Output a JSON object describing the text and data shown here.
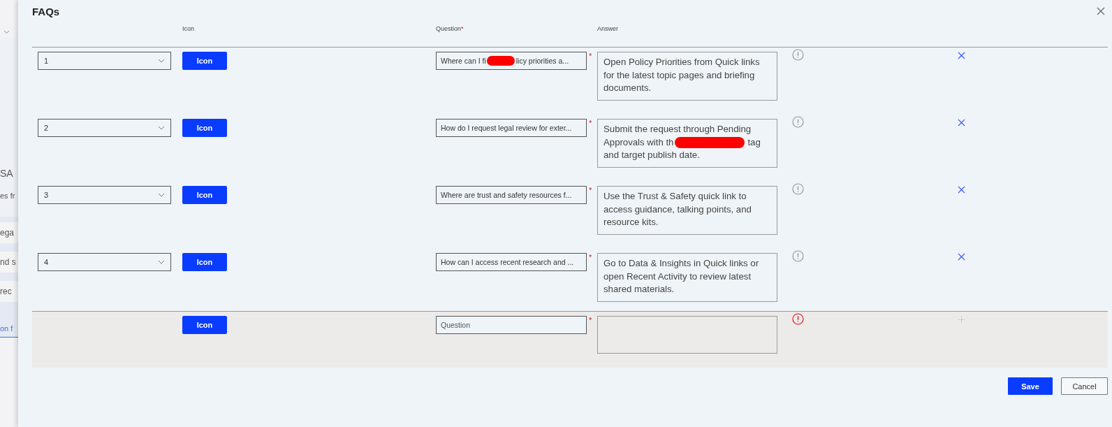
{
  "background_page": {
    "fragments": [
      {
        "kind": "heading",
        "text": "SA"
      },
      {
        "kind": "text",
        "text": "es fr"
      },
      {
        "kind": "chip",
        "text": "ega"
      },
      {
        "kind": "chip",
        "text": "nd s"
      },
      {
        "kind": "chip",
        "text": "rec"
      },
      {
        "kind": "link",
        "text": "on f"
      }
    ]
  },
  "dialog": {
    "title": "FAQs",
    "columns": [
      {
        "label": "Icon"
      },
      {
        "label": "Question",
        "required_mark": "*"
      },
      {
        "label": "Answer"
      }
    ],
    "rows": [
      {
        "kind": "item",
        "order": "1",
        "icon_button": "Icon",
        "question": [
          {
            "kind": "text",
            "text": "Where can I fi"
          },
          {
            "kind": "redaction"
          },
          {
            "kind": "text",
            "text": "licy priorities a..."
          }
        ],
        "required_mark": "*",
        "answer": [
          {
            "kind": "text",
            "text": "Open Policy Priorities from Quick links for the latest topic pages and briefing documents."
          }
        ],
        "error": false
      },
      {
        "kind": "item",
        "order": "2",
        "icon_button": "Icon",
        "question": [
          {
            "kind": "text",
            "text": "How do I request legal review for exter..."
          }
        ],
        "required_mark": "*",
        "answer": [
          {
            "kind": "text",
            "text": "Submit the request through Pending Approvals with th"
          },
          {
            "kind": "redaction"
          },
          {
            "kind": "text",
            "text": "tag and target publish date."
          }
        ],
        "error": false
      },
      {
        "kind": "item",
        "order": "3",
        "icon_button": "Icon",
        "question": [
          {
            "kind": "text",
            "text": "Where are trust and safety resources f..."
          }
        ],
        "required_mark": "*",
        "answer": [
          {
            "kind": "text",
            "text": "Use the Trust & Safety quick link to access guidance, talking points, and resource kits."
          }
        ],
        "error": false
      },
      {
        "kind": "item",
        "order": "4",
        "icon_button": "Icon",
        "question": [
          {
            "kind": "text",
            "text": "How can I access recent research and ..."
          }
        ],
        "required_mark": "*",
        "answer": [
          {
            "kind": "text",
            "text": "Go to Data & Insights in Quick links or open Recent Activity to review latest shared materials."
          }
        ],
        "error": false
      },
      {
        "kind": "new",
        "icon_button": "Icon",
        "question_placeholder": "Question",
        "required_mark": "*",
        "error": true
      }
    ],
    "buttons": [
      {
        "label": "Save",
        "kind": "primary"
      },
      {
        "label": "Cancel",
        "kind": "secondary"
      }
    ]
  }
}
